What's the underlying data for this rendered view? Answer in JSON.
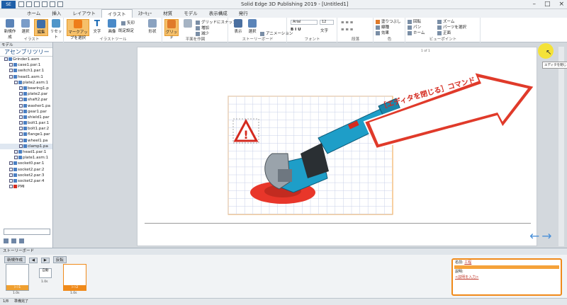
{
  "window": {
    "title": "Solid Edge 3D Publishing 2019 - [Untitled1]",
    "app_logo": "SE"
  },
  "tabs": [
    "ホーム",
    "挿入",
    "レイアウト",
    "イラスト",
    "ｽﾀｰｷｭｰ",
    "材質",
    "モデル",
    "表示構成",
    "発行"
  ],
  "ribbon": {
    "illust_group": {
      "label": "イラスト",
      "buttons": [
        "新規作成",
        "選択",
        "編集",
        "リセット"
      ]
    },
    "tools_group": {
      "label": "イラストツール",
      "buttons": [
        "マークアップを選択",
        "文字",
        "画像",
        "形状"
      ],
      "small": [
        "矢印"
      ],
      "defaults_label": "既定設定"
    },
    "plane_group": {
      "label": "平面を作図",
      "buttons": [
        "グリッド",
        "平面を作図"
      ],
      "small": [
        "グリッドにスナップ",
        "増加",
        "減少"
      ]
    },
    "storyboard_group": {
      "label": "ストーリーボード",
      "buttons": [
        "表示",
        "選択"
      ],
      "small": [
        "アニメーション"
      ]
    },
    "font_group": {
      "label": "フォント",
      "font": "Arial",
      "size": "12",
      "text_label": "文字"
    },
    "para_group": {
      "label": "段落"
    },
    "color_group": {
      "label": "色",
      "small": [
        "塗りつぶし",
        "線種",
        "効果"
      ]
    },
    "view_group": {
      "label": "ビューポイント",
      "small": [
        "回転",
        "パン",
        "ホーム",
        "ズーム",
        "パーツを選択",
        "正面"
      ]
    }
  },
  "left_panel": {
    "header": "モデル",
    "title": "アセンブリツリー",
    "tree": [
      {
        "level": 0,
        "label": "Grinder1.asm",
        "checked": true
      },
      {
        "level": 1,
        "label": "case1.par:1",
        "checked": true
      },
      {
        "level": 1,
        "label": "switch1.par:1",
        "checked": true
      },
      {
        "level": 1,
        "label": "head1.asm:1",
        "checked": true
      },
      {
        "level": 2,
        "label": "plate2.asm:1",
        "checked": true
      },
      {
        "level": 3,
        "label": "bearing1.p",
        "checked": true
      },
      {
        "level": 3,
        "label": "plate2.par",
        "checked": true
      },
      {
        "level": 3,
        "label": "shaft2.par",
        "checked": true
      },
      {
        "level": 3,
        "label": "washer1.pa",
        "checked": true
      },
      {
        "level": 3,
        "label": "gear1.par",
        "checked": true
      },
      {
        "level": 3,
        "label": "shield1.par",
        "checked": true
      },
      {
        "level": 3,
        "label": "bolt1.par:1",
        "checked": true
      },
      {
        "level": 3,
        "label": "bolt1.par:2",
        "checked": true
      },
      {
        "level": 3,
        "label": "flange1.par",
        "checked": true
      },
      {
        "level": 3,
        "label": "wheel1.pa",
        "checked": true
      },
      {
        "level": 3,
        "label": "clamp1.pa",
        "checked": true
      },
      {
        "level": 2,
        "label": "head1.par:1",
        "checked": true
      },
      {
        "level": 2,
        "label": "plate1.asm:1",
        "checked": true
      },
      {
        "level": 1,
        "label": "socket0.par:1",
        "checked": true
      },
      {
        "level": 1,
        "label": "socket2.par:2",
        "checked": true
      },
      {
        "level": 1,
        "label": "socket2.par:3",
        "checked": true
      },
      {
        "level": 1,
        "label": "socket2.par:4",
        "checked": true
      },
      {
        "level": 1,
        "label": "PMI",
        "checked": false
      }
    ]
  },
  "canvas": {
    "page_number": "1 of 1",
    "callout": "［エディタを閉じる］コマンド",
    "tooltip": "エディタを閉じる",
    "warning_symbol": "!"
  },
  "storyboard": {
    "header": "ストーリーボード",
    "new_button": "新規作成",
    "play_label": "反転",
    "auto_label": "自動",
    "auto_time": "1.0s",
    "thumbs": [
      {
        "label": "ｼｰﾝ1",
        "time": "1.0s",
        "color": "#f0a030"
      },
      {
        "label": "ｼｰﾝ2",
        "time": "1.0s",
        "color": "#f08a1a"
      }
    ]
  },
  "properties": {
    "name_label": "名前:",
    "name_value": "工程",
    "desc_label": "説明:",
    "desc_value": "<説明を入力>"
  },
  "status": {
    "page": "1/8",
    "text": "準備完了"
  },
  "colors": {
    "accent": "#f08a1a",
    "callout_red": "#e03a2a",
    "grinder_teal": "#1e9ec8"
  }
}
